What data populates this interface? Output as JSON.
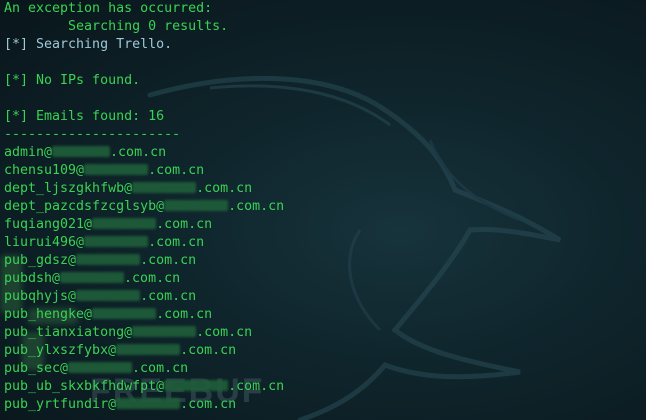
{
  "terminal": {
    "lines": [
      {
        "text": "An exception has occurred:",
        "style": "green"
      },
      {
        "text": "        Searching 0 results.",
        "style": "green"
      },
      {
        "text": "[*] Searching Trello.",
        "style": "blue"
      },
      {
        "text": "",
        "style": "green"
      },
      {
        "text": "[*] No IPs found.",
        "style": "green"
      },
      {
        "text": "",
        "style": "green"
      },
      {
        "text": "[*] Emails found: 16",
        "style": "green"
      },
      {
        "text": "----------------------",
        "style": "green"
      }
    ],
    "emails": [
      {
        "pre": "admin@",
        "blur": 58,
        "post": ".com.cn"
      },
      {
        "pre": "chensu109@",
        "blur": 64,
        "post": ".com.cn"
      },
      {
        "pre": "dept_ljszgkhfwb@",
        "blur": 64,
        "post": ".com.cn"
      },
      {
        "pre": "dept_pazcdsfzcglsyb@",
        "blur": 64,
        "post": ".com.cn"
      },
      {
        "pre": "fuqiang021@",
        "blur": 64,
        "post": ".com.cn"
      },
      {
        "pre": "liurui496@",
        "blur": 64,
        "post": ".com.cn"
      },
      {
        "pre": "pub_gdsz@",
        "blur": 64,
        "post": ".com.cn"
      },
      {
        "pre": "pubdsh@",
        "blur": 64,
        "post": ".com.cn"
      },
      {
        "pre": "pubqhyjs@",
        "blur": 64,
        "post": ".com.cn"
      },
      {
        "pre": "pub_hengke@",
        "blur": 64,
        "post": ".com.cn"
      },
      {
        "pre": "pub_tianxiatong@",
        "blur": 64,
        "post": ".com.cn"
      },
      {
        "pre": "pub_ylxszfybx@",
        "blur": 64,
        "post": ".com.cn"
      },
      {
        "pre": "pub_sec@",
        "blur": 64,
        "post": ".com.cn"
      },
      {
        "pre": "pub_ub_skxbkfhdwfpt@",
        "blur": 64,
        "post": ".com.cn"
      },
      {
        "pre": "pub_yrtfundir@",
        "blur": 64,
        "post": ".com.cn"
      }
    ]
  },
  "colors": {
    "green": "#39d353",
    "blue": "#9fc8d8",
    "background": "#0a1e24"
  }
}
